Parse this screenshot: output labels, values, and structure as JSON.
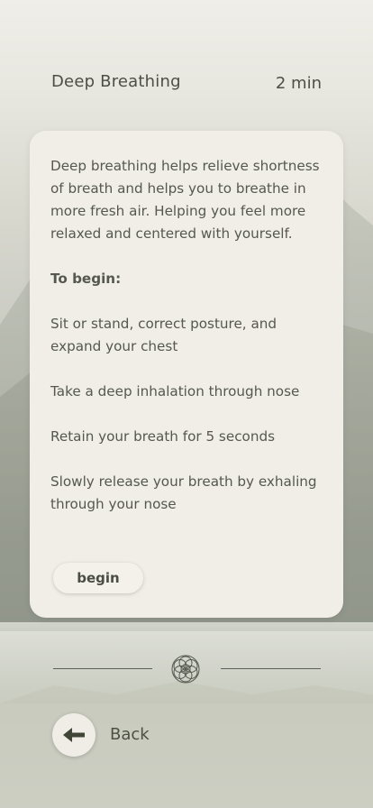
{
  "header": {
    "title": "Deep Breathing",
    "duration": "2 min"
  },
  "card": {
    "intro": "Deep breathing helps relieve shortness of breath  and helps you to breathe in more fresh air. Helping you  feel more relaxed and centered with yourself.",
    "heading": "To begin:",
    "steps": [
      "Sit or stand, correct posture, and expand your chest",
      "Take a deep inhalation through nose",
      "Retain your breath for 5 seconds",
      "Slowly release your breath by exhaling through your nose"
    ],
    "begin_label": "begin"
  },
  "divider": {
    "icon": "flower-of-life-icon"
  },
  "footer": {
    "back_label": "Back",
    "back_icon": "arrow-left-icon"
  },
  "colors": {
    "text": "#4c4f45",
    "card_bg": "#f0eee7",
    "accent": "#4a4d43"
  }
}
